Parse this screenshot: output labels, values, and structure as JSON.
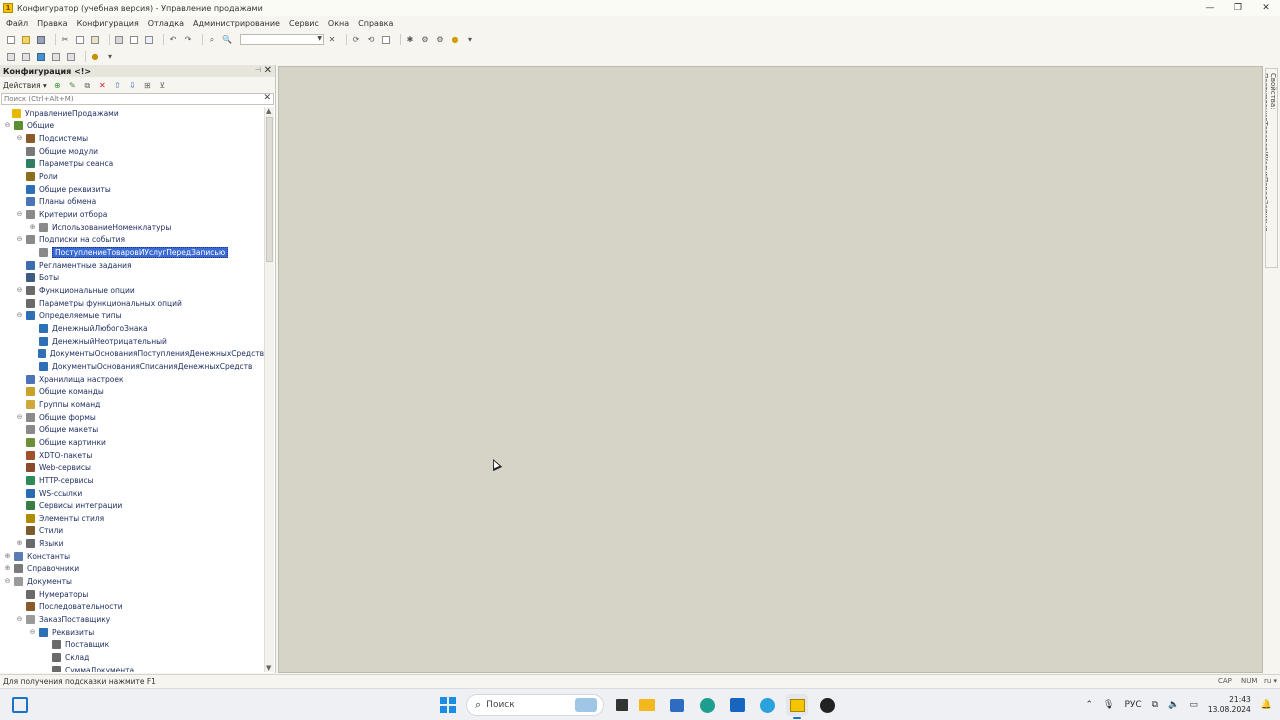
{
  "window": {
    "title": "Конфигуратор (учебная версия) - Управление продажами",
    "controls": [
      "—",
      "❐",
      "✕"
    ]
  },
  "menu": [
    "Файл",
    "Правка",
    "Конфигурация",
    "Отладка",
    "Администрирование",
    "Сервис",
    "Окна",
    "Справка"
  ],
  "panel": {
    "title": "Конфигурация <!>",
    "actions_label": "Действия ▾",
    "search_placeholder": "Поиск (Ctrl+Alt+M)",
    "tree": [
      {
        "label": "УправлениеПродажами",
        "level": 0,
        "exp": "",
        "icon": "config-root-icon",
        "color": "#e6b800"
      },
      {
        "label": "Общие",
        "level": 1,
        "exp": "⊖",
        "icon": "common-icon",
        "color": "#5b8f2f"
      },
      {
        "label": "Подсистемы",
        "level": 2,
        "exp": "⊖",
        "icon": "subsystems-icon",
        "color": "#8a5a2b"
      },
      {
        "label": "Общие модули",
        "level": 2,
        "exp": "",
        "icon": "module-icon",
        "color": "#7a7a7a"
      },
      {
        "label": "Параметры сеанса",
        "level": 2,
        "exp": "",
        "icon": "session-param-icon",
        "color": "#2e7d64"
      },
      {
        "label": "Роли",
        "level": 2,
        "exp": "",
        "icon": "role-icon",
        "color": "#8d6e1f"
      },
      {
        "label": "Общие реквизиты",
        "level": 2,
        "exp": "",
        "icon": "attribute-icon",
        "color": "#2f6fb5"
      },
      {
        "label": "Планы обмена",
        "level": 2,
        "exp": "",
        "icon": "exchange-plan-icon",
        "color": "#4a73b8"
      },
      {
        "label": "Критерии отбора",
        "level": 2,
        "exp": "⊖",
        "icon": "filter-criteria-icon",
        "color": "#8a8a8a"
      },
      {
        "label": "ИспользованиеНоменклатуры",
        "level": 3,
        "exp": "⊕",
        "icon": "filter-criteria-item-icon",
        "color": "#8a8a8a"
      },
      {
        "label": "Подписки на события",
        "level": 2,
        "exp": "⊖",
        "icon": "event-subscription-icon",
        "color": "#8a8a8a"
      },
      {
        "label": "ПоступлениеТоваровИУслугПередЗаписью",
        "level": 3,
        "exp": "",
        "icon": "event-subscription-item-icon",
        "color": "#8a8a8a",
        "selected": true
      },
      {
        "label": "Регламентные задания",
        "level": 2,
        "exp": "",
        "icon": "scheduled-job-icon",
        "color": "#3c6db0"
      },
      {
        "label": "Боты",
        "level": 2,
        "exp": "",
        "icon": "bot-icon",
        "color": "#3d5a80"
      },
      {
        "label": "Функциональные опции",
        "level": 2,
        "exp": "⊖",
        "icon": "functional-option-icon",
        "color": "#6a6a6a"
      },
      {
        "label": "Параметры функциональных опций",
        "level": 2,
        "exp": "",
        "icon": "functional-option-param-icon",
        "color": "#6a6a6a"
      },
      {
        "label": "Определяемые типы",
        "level": 2,
        "exp": "⊖",
        "icon": "defined-type-icon",
        "color": "#2f6fb5"
      },
      {
        "label": "ДенежныйЛюбогоЗнака",
        "level": 3,
        "exp": "",
        "icon": "defined-type-item-icon",
        "color": "#2f6fb5"
      },
      {
        "label": "ДенежныйНеотрицательный",
        "level": 3,
        "exp": "",
        "icon": "defined-type-item-icon",
        "color": "#2f6fb5"
      },
      {
        "label": "ДокументыОснованияПоступленияДенежныхСредств",
        "level": 3,
        "exp": "",
        "icon": "defined-type-item-icon",
        "color": "#2f6fb5"
      },
      {
        "label": "ДокументыОснованияСписанияДенежныхСредств",
        "level": 3,
        "exp": "",
        "icon": "defined-type-item-icon",
        "color": "#2f6fb5"
      },
      {
        "label": "Хранилища настроек",
        "level": 2,
        "exp": "",
        "icon": "settings-storage-icon",
        "color": "#4a73b8"
      },
      {
        "label": "Общие команды",
        "level": 2,
        "exp": "",
        "icon": "common-command-icon",
        "color": "#c9a227"
      },
      {
        "label": "Группы команд",
        "level": 2,
        "exp": "",
        "icon": "command-group-icon",
        "color": "#d0a83a"
      },
      {
        "label": "Общие формы",
        "level": 2,
        "exp": "⊖",
        "icon": "common-form-icon",
        "color": "#8a8a8a"
      },
      {
        "label": "Общие макеты",
        "level": 2,
        "exp": "",
        "icon": "common-template-icon",
        "color": "#8a8a8a"
      },
      {
        "label": "Общие картинки",
        "level": 2,
        "exp": "",
        "icon": "common-picture-icon",
        "color": "#6d8f3a"
      },
      {
        "label": "XDTO-пакеты",
        "level": 2,
        "exp": "",
        "icon": "xdto-package-icon",
        "color": "#a0522d"
      },
      {
        "label": "Web-сервисы",
        "level": 2,
        "exp": "",
        "icon": "web-service-icon",
        "color": "#8a4b2b"
      },
      {
        "label": "HTTP-сервисы",
        "level": 2,
        "exp": "",
        "icon": "http-service-icon",
        "color": "#2e8b57"
      },
      {
        "label": "WS-ссылки",
        "level": 2,
        "exp": "",
        "icon": "ws-reference-icon",
        "color": "#2a6bb3"
      },
      {
        "label": "Сервисы интеграции",
        "level": 2,
        "exp": "",
        "icon": "integration-service-icon",
        "color": "#3a7d44"
      },
      {
        "label": "Элементы стиля",
        "level": 2,
        "exp": "",
        "icon": "style-item-icon",
        "color": "#b08b00"
      },
      {
        "label": "Стили",
        "level": 2,
        "exp": "",
        "icon": "style-icon",
        "color": "#7a5c2e"
      },
      {
        "label": "Языки",
        "level": 2,
        "exp": "⊕",
        "icon": "language-icon",
        "color": "#6a6a6a"
      },
      {
        "label": "Константы",
        "level": 1,
        "exp": "⊕",
        "icon": "constants-icon",
        "color": "#5a7db5"
      },
      {
        "label": "Справочники",
        "level": 1,
        "exp": "⊕",
        "icon": "catalogs-icon",
        "color": "#7a7a7a"
      },
      {
        "label": "Документы",
        "level": 1,
        "exp": "⊖",
        "icon": "documents-icon",
        "color": "#9a9a9a"
      },
      {
        "label": "Нумераторы",
        "level": 2,
        "exp": "",
        "icon": "numerator-icon",
        "color": "#6a6a6a"
      },
      {
        "label": "Последовательности",
        "level": 2,
        "exp": "",
        "icon": "sequence-icon",
        "color": "#8a5a2b"
      },
      {
        "label": "ЗаказПоставщику",
        "level": 2,
        "exp": "⊖",
        "icon": "document-icon",
        "color": "#9a9a9a"
      },
      {
        "label": "Реквизиты",
        "level": 3,
        "exp": "⊖",
        "icon": "attributes-icon",
        "color": "#2f6fb5"
      },
      {
        "label": "Поставщик",
        "level": 4,
        "exp": "",
        "icon": "attribute-item-icon",
        "color": "#6a6a6a"
      },
      {
        "label": "Склад",
        "level": 4,
        "exp": "",
        "icon": "attribute-item-icon",
        "color": "#6a6a6a"
      },
      {
        "label": "СуммаДокумента",
        "level": 4,
        "exp": "",
        "icon": "attribute-item-icon",
        "color": "#6a6a6a"
      }
    ]
  },
  "right_dock": {
    "tab_label": "Свойства: ПоступлениеТоваровИУслугПередЗаписью"
  },
  "status": {
    "hint": "Для получения подсказки нажмите F1",
    "cap": "CAP",
    "num": "NUM",
    "lang": "ru ▾"
  },
  "taskbar": {
    "search_label": "Поиск",
    "tray_lang": "РУС",
    "time": "21:43",
    "date": "13.08.2024"
  },
  "colors": {
    "workspace": "#d6d4c6",
    "selection": "#3a6ad3",
    "accent": "#1a73c9"
  }
}
